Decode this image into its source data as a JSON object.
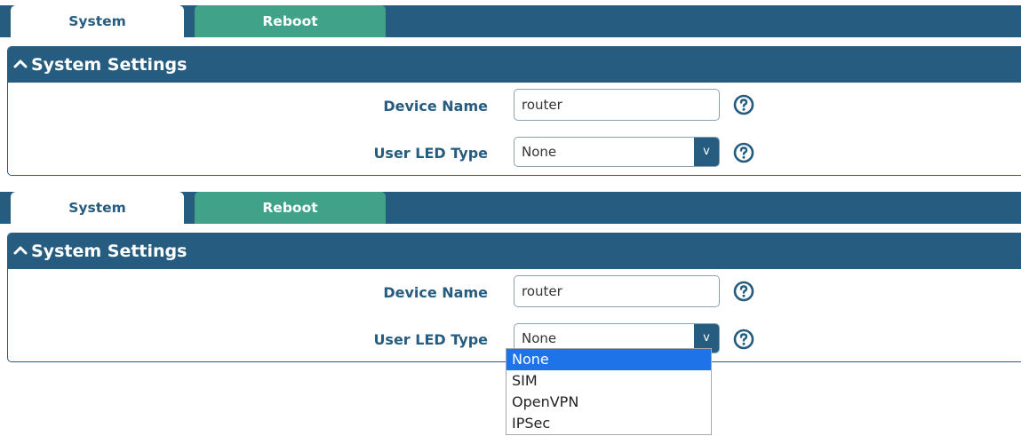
{
  "tabs": [
    {
      "label": "System",
      "active": true
    },
    {
      "label": "Reboot",
      "active": false
    }
  ],
  "section": {
    "title": "System Settings"
  },
  "fields": {
    "device_name": {
      "label": "Device Name",
      "value": "router"
    },
    "user_led_type": {
      "label": "User LED Type",
      "value": "None",
      "arrow": "v"
    }
  },
  "dropdown_options": [
    "None",
    "SIM",
    "OpenVPN",
    "IPSec"
  ],
  "colors": {
    "header": "#255c7f",
    "tab_accent": "#3fa289",
    "selected": "#1e73e8"
  },
  "icons": {
    "collapse": "chevron-up-icon",
    "help": "help-circle-icon"
  }
}
